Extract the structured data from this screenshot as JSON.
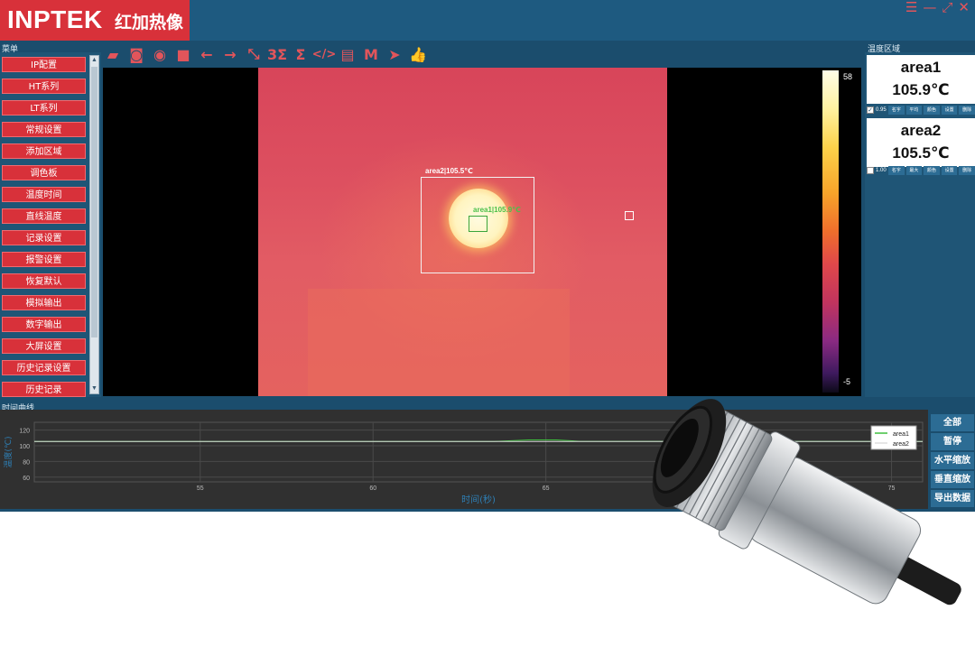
{
  "header": {
    "brand": "INPTEK",
    "brand_cn": "红加热像",
    "window_controls": [
      "☰",
      "—",
      "⤢",
      "✕"
    ]
  },
  "menu": {
    "title": "菜单",
    "items": [
      {
        "label": "IP配置"
      },
      {
        "label": "HT系列"
      },
      {
        "label": "LT系列"
      },
      {
        "label": "常规设置"
      },
      {
        "label": "添加区域"
      },
      {
        "label": "调色板"
      },
      {
        "label": "温度时间"
      },
      {
        "label": "直线温度"
      },
      {
        "label": "记录设置"
      },
      {
        "label": "报警设置"
      },
      {
        "label": "恢复默认"
      },
      {
        "label": "模拟输出"
      },
      {
        "label": "数字输出"
      },
      {
        "label": "大屏设置"
      },
      {
        "label": "历史记录设置"
      },
      {
        "label": "历史记录"
      }
    ]
  },
  "toolbar": {
    "icons": [
      {
        "name": "folder-icon",
        "glyph": "▰"
      },
      {
        "name": "camera-icon",
        "glyph": "◙"
      },
      {
        "name": "record-icon",
        "glyph": "◉"
      },
      {
        "name": "stop-icon",
        "glyph": "■"
      },
      {
        "name": "arrow-left-icon",
        "glyph": "←"
      },
      {
        "name": "arrow-right-icon",
        "glyph": "→"
      },
      {
        "name": "fit-icon",
        "glyph": "⤡"
      },
      {
        "name": "sum3-icon",
        "glyph": "3Σ"
      },
      {
        "name": "sigma-icon",
        "glyph": "Σ"
      },
      {
        "name": "code-icon",
        "glyph": "</>"
      },
      {
        "name": "doc-icon",
        "glyph": "▤"
      },
      {
        "name": "m-icon",
        "glyph": "M"
      },
      {
        "name": "play-icon",
        "glyph": "➤"
      },
      {
        "name": "thumbs-up-icon",
        "glyph": "👍"
      }
    ]
  },
  "view": {
    "roi_area2_label": "area2|105.5℃",
    "roi_area1_label": "area1|105.9℃",
    "colorbar_max": "58",
    "colorbar_min": "-5"
  },
  "right_panel": {
    "title": "温度区域",
    "areas": [
      {
        "name": "area1",
        "value": "105.9℃",
        "checked": "✓",
        "emissivity": "0.95",
        "buttons": [
          "名字",
          "平均",
          "颜色",
          "设置",
          "删除"
        ]
      },
      {
        "name": "area2",
        "value": "105.5℃",
        "checked": "",
        "emissivity": "1.00",
        "buttons": [
          "名字",
          "最大",
          "颜色",
          "设置",
          "删除"
        ]
      }
    ]
  },
  "chart_panel": {
    "title": "时间曲线",
    "buttons": [
      "全部",
      "暂停",
      "水平缩放",
      "垂直缩放",
      "导出数据"
    ]
  },
  "chart_data": {
    "type": "line",
    "xlabel": "时间(秒)",
    "ylabel": "温度(℃)",
    "x_ticks": [
      55,
      60,
      65,
      70,
      75
    ],
    "y_ticks": [
      60,
      80,
      100,
      120
    ],
    "xlim": [
      50.2,
      75.9
    ],
    "ylim": [
      54,
      130
    ],
    "grid": true,
    "legend_position": "top-right",
    "series": [
      {
        "name": "area1",
        "color": "#3fbf3f",
        "x": [
          50.2,
          63.5,
          64.5,
          65.3,
          66.0,
          75.9
        ],
        "y": [
          105.6,
          105.6,
          107.5,
          107.6,
          105.7,
          105.6
        ]
      },
      {
        "name": "area2",
        "color": "#dddddd",
        "x": [
          50.2,
          75.9
        ],
        "y": [
          105.5,
          105.5
        ]
      }
    ]
  },
  "colors": {
    "brand_red": "#d8313a",
    "panel_blue": "#1b4d6d",
    "button_blue": "#2c6c94"
  }
}
